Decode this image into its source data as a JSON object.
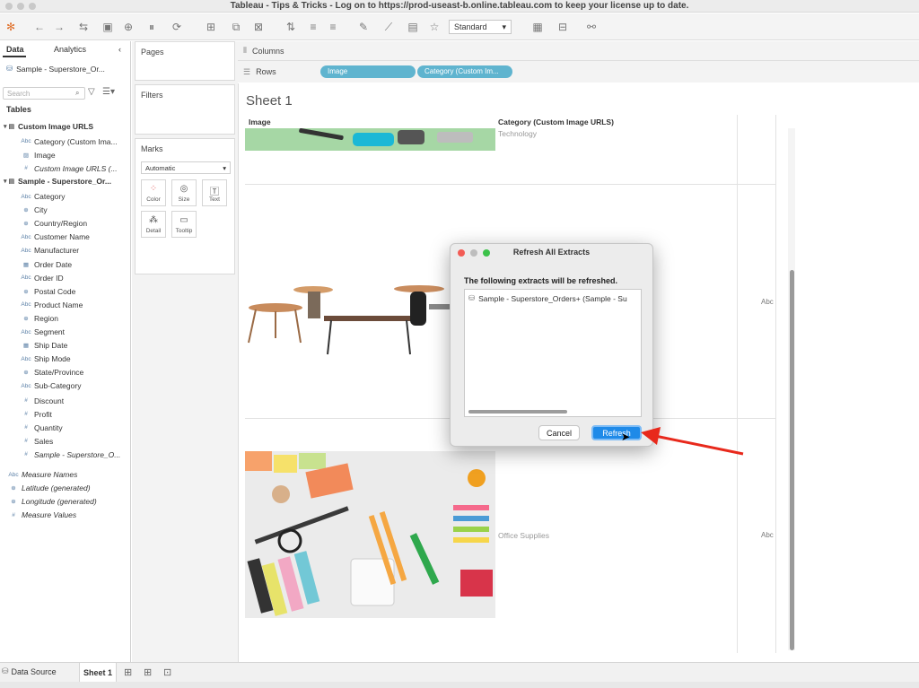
{
  "window": {
    "title": "Tableau - Tips & Tricks - Log on to https://prod-useast-b.online.tableau.com to keep your license up to date."
  },
  "toolbar": {
    "fit_label": "Standard"
  },
  "left_pane": {
    "tabs": [
      "Data",
      "Analytics"
    ],
    "datasource": "Sample - Superstore_Or...",
    "search_placeholder": "Search",
    "tables_label": "Tables",
    "groups": [
      {
        "name": "Custom Image URLS",
        "fields": [
          {
            "icon": "Abc",
            "label": "Category (Custom Ima..."
          },
          {
            "icon": "img",
            "label": "Image"
          },
          {
            "icon": "#",
            "label": "Custom Image URLS (..."
          }
        ]
      },
      {
        "name": "Sample - Superstore_Or...",
        "fields": [
          {
            "icon": "Abc",
            "label": "Category"
          },
          {
            "icon": "globe",
            "label": "City"
          },
          {
            "icon": "globe",
            "label": "Country/Region"
          },
          {
            "icon": "Abc",
            "label": "Customer Name"
          },
          {
            "icon": "Abc",
            "label": "Manufacturer"
          },
          {
            "icon": "cal",
            "label": "Order Date"
          },
          {
            "icon": "Abc",
            "label": "Order ID"
          },
          {
            "icon": "globe",
            "label": "Postal Code"
          },
          {
            "icon": "Abc",
            "label": "Product Name"
          },
          {
            "icon": "globe",
            "label": "Region"
          },
          {
            "icon": "Abc",
            "label": "Segment"
          },
          {
            "icon": "cal",
            "label": "Ship Date"
          },
          {
            "icon": "Abc",
            "label": "Ship Mode"
          },
          {
            "icon": "globe",
            "label": "State/Province"
          },
          {
            "icon": "Abc",
            "label": "Sub-Category"
          },
          {
            "icon": "#",
            "label": "Discount"
          },
          {
            "icon": "#",
            "label": "Profit"
          },
          {
            "icon": "#",
            "label": "Quantity"
          },
          {
            "icon": "#",
            "label": "Sales"
          },
          {
            "icon": "#",
            "label": "Sample - Superstore_O..."
          }
        ]
      }
    ],
    "extra_fields": [
      {
        "icon": "Abc",
        "label": "Measure Names"
      },
      {
        "icon": "globe",
        "label": "Latitude (generated)"
      },
      {
        "icon": "globe",
        "label": "Longitude (generated)"
      },
      {
        "icon": "#",
        "label": "Measure Values"
      }
    ]
  },
  "cards": {
    "pages": "Pages",
    "filters": "Filters",
    "marks": "Marks",
    "mark_type": "Automatic",
    "mark_buttons": [
      "Color",
      "Size",
      "Text",
      "Detail",
      "Tooltip"
    ]
  },
  "shelves": {
    "columns_label": "Columns",
    "rows_label": "Rows",
    "row_pills": [
      "Image",
      "Category (Custom Im..."
    ]
  },
  "sheet": {
    "title": "Sheet 1",
    "col_headers": [
      "Image",
      "Category (Custom Image URLS)"
    ],
    "rows": [
      {
        "category": "Technology",
        "abc": ""
      },
      {
        "category": "",
        "abc": "Abc"
      },
      {
        "category": "Office Supplies",
        "abc": "Abc"
      }
    ]
  },
  "dialog": {
    "title": "Refresh All Extracts",
    "message": "The following extracts will be refreshed.",
    "items": [
      "Sample - Superstore_Orders+ (Sample - Su"
    ],
    "cancel_label": "Cancel",
    "refresh_label": "Refresh"
  },
  "bottom": {
    "data_source_tab": "Data Source",
    "sheet_tab": "Sheet 1"
  },
  "colors": {
    "accent": "#1f8ae8",
    "pill": "#5fb4cf",
    "arrow": "#e8291c"
  }
}
